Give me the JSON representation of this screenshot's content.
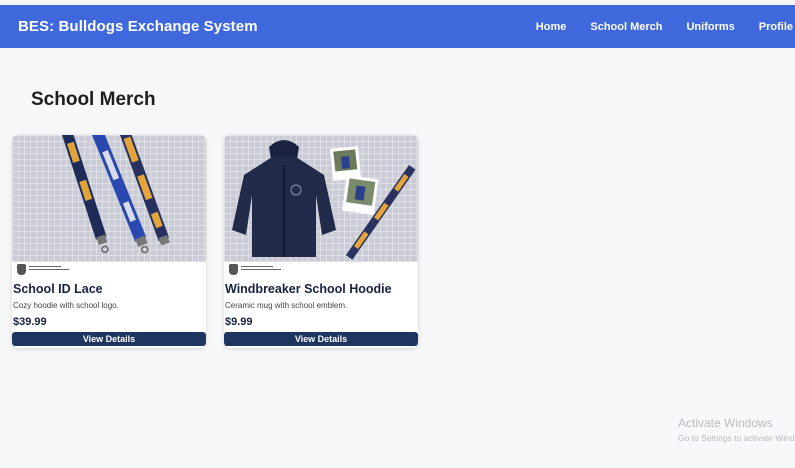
{
  "app": {
    "title": "BES: Bulldogs Exchange System"
  },
  "nav": {
    "items": [
      {
        "label": "Home"
      },
      {
        "label": "School Merch"
      },
      {
        "label": "Uniforms"
      },
      {
        "label": "Profile"
      }
    ]
  },
  "page": {
    "title": "School Merch"
  },
  "products": [
    {
      "name": "School ID Lace",
      "description": "Cozy hoodie with school logo.",
      "price": "$39.99",
      "button": "View Details",
      "image": "lanyards"
    },
    {
      "name": "Windbreaker School Hoodie",
      "description": "Ceramic mug with school emblem.",
      "price": "$9.99",
      "button": "View Details",
      "image": "hoodie"
    }
  ],
  "watermark": {
    "title": "Activate Windows",
    "subtitle": "Go to Settings to activate Windows."
  },
  "colors": {
    "navbar": "#3f68dd",
    "button": "#1e3560",
    "text_dark": "#152241"
  }
}
